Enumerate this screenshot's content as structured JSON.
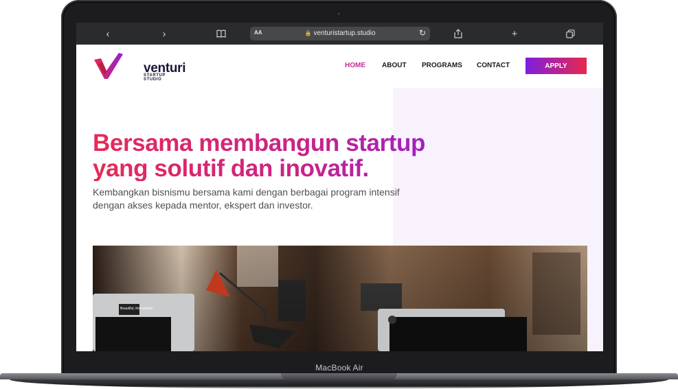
{
  "browser": {
    "url": "venturistartup.studio",
    "text_size_label": "AA"
  },
  "site": {
    "brand_name": "venturi",
    "brand_tagline": "STARTUP STUDIO",
    "nav": [
      {
        "label": "HOME",
        "active": true
      },
      {
        "label": "ABOUT",
        "active": false
      },
      {
        "label": "PROGRAMS",
        "active": false
      },
      {
        "label": "CONTACT",
        "active": false
      }
    ],
    "apply_label": "APPLY",
    "hero": {
      "title_line1": "Bersama membangun startup",
      "title_line2": "yang solutif dan inovatif.",
      "subtitle_line1": "Kembangkan bisnismu bersama kami dengan berbagai program intensif",
      "subtitle_line2": "dengan akses kepada mentor, ekspert dan investor."
    },
    "photo_sticker": "Beautiful, free photos."
  },
  "device": {
    "label": "MacBook Air"
  },
  "colors": {
    "accent_start": "#7d1fe0",
    "accent_end": "#e8284b",
    "nav_active": "#c22f9a",
    "hero_bg": "#f8f2fd"
  }
}
